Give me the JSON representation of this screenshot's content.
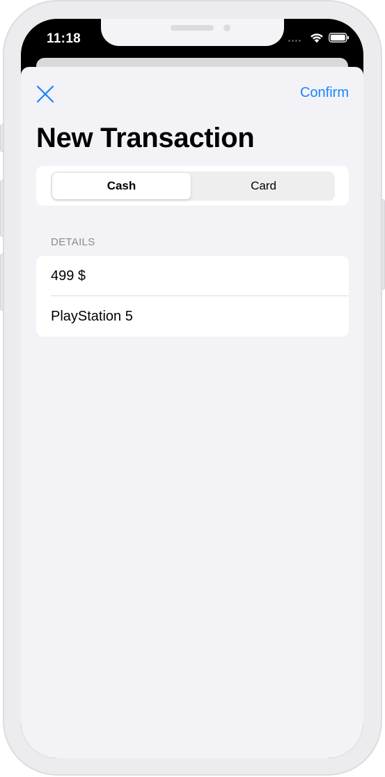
{
  "status_bar": {
    "time": "11:18"
  },
  "header": {
    "close_icon": "close-x-icon",
    "confirm_label": "Confirm",
    "title": "New Transaction"
  },
  "payment_type": {
    "options": [
      "Cash",
      "Card"
    ],
    "selected": "Cash"
  },
  "details": {
    "section_label": "DETAILS",
    "amount": "499 $",
    "item_name": "PlayStation 5"
  },
  "colors": {
    "accent": "#1a84ff",
    "background": "#f2f2f7",
    "card": "#ffffff",
    "secondary_text": "#8a8a8e"
  }
}
